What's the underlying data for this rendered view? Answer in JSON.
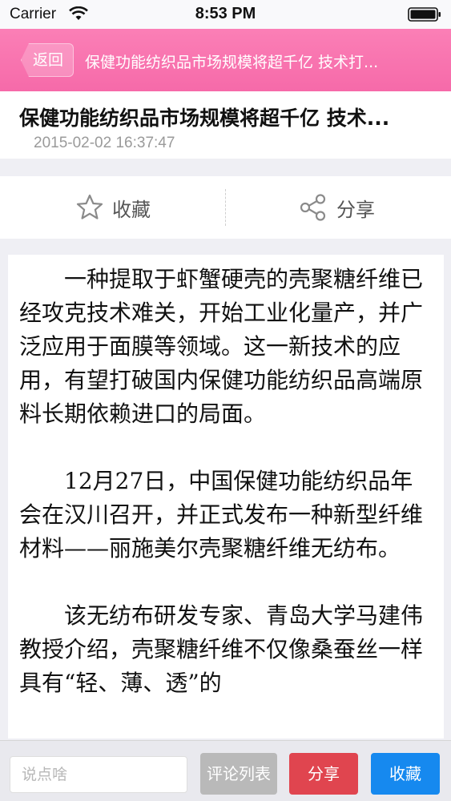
{
  "status_bar": {
    "carrier": "Carrier",
    "time": "8:53 PM",
    "wifi_icon": "wifi-icon",
    "battery_icon": "battery-icon"
  },
  "nav": {
    "back_label": "返回",
    "title": "保健功能纺织品市场规模将超千亿 技术打...",
    "color": "#f870ae"
  },
  "article": {
    "title": "保健功能纺织品市场规模将超千亿 技术...",
    "time": "2015-02-02 16:37:47",
    "paragraphs": [
      "一种提取于虾蟹硬壳的壳聚糖纤维已经攻克技术难关，开始工业化量产，并广泛应用于面膜等领域。这一新技术的应用，有望打破国内保健功能纺织品高端原料长期依赖进口的局面。",
      "12月27日，中国保健功能纺织品年会在汉川召开，并正式发布一种新型纤维材料——丽施美尔壳聚糖纤维无纺布。",
      "该无纺布研发专家、青岛大学马建伟教授介绍，壳聚糖纤维不仅像桑蚕丝一样具有“轻、薄、透”的"
    ]
  },
  "actions": {
    "favorite": {
      "label": "收藏",
      "icon": "star-icon"
    },
    "share": {
      "label": "分享",
      "icon": "share-icon"
    }
  },
  "bottom_bar": {
    "input_placeholder": "说点啥",
    "comment_list_label": "评论列表",
    "share_label": "分享",
    "favorite_label": "收藏",
    "colors": {
      "comment_list": "#b9b9b9",
      "share": "#e0454f",
      "favorite": "#1689ef"
    }
  }
}
